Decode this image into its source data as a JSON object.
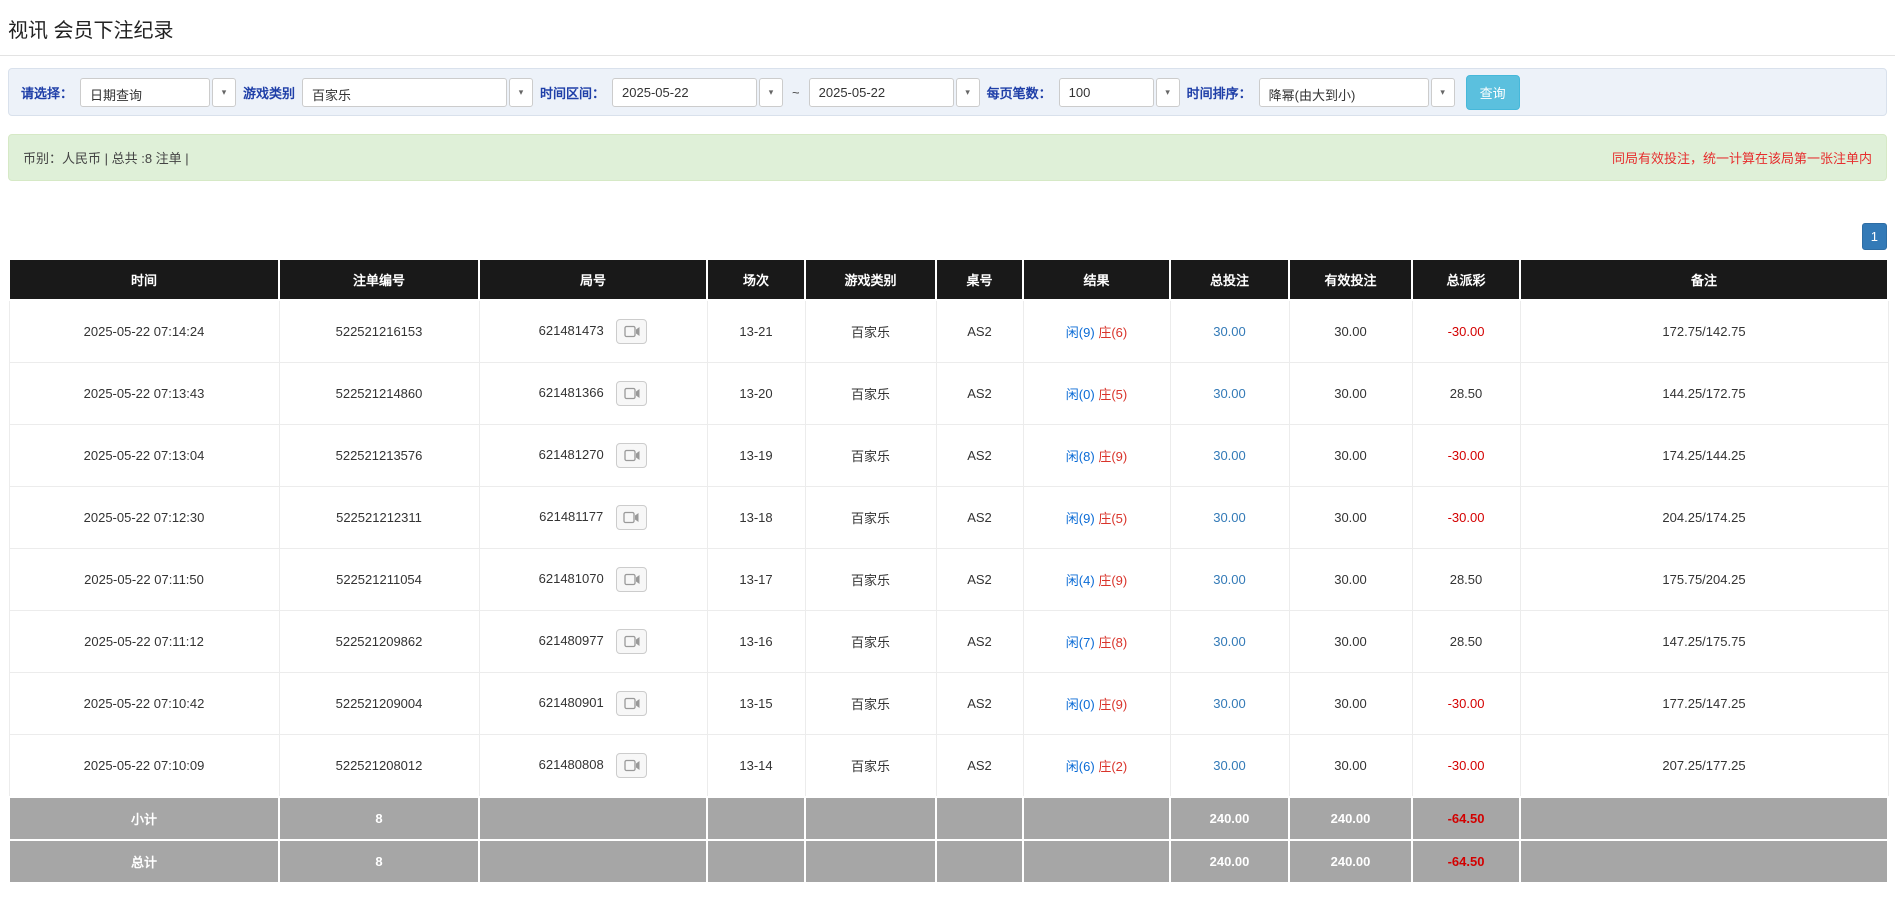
{
  "page": {
    "title": "视讯 会员下注纪录"
  },
  "filters": {
    "select_label": "请选择：",
    "select_value": "日期查询",
    "game_type_label": "游戏类别",
    "game_type_value": "百家乐",
    "date_range_label": "时间区间：",
    "date_from": "2025-05-22",
    "date_separator": "~",
    "date_to": "2025-05-22",
    "page_size_label": "每页笔数：",
    "page_size_value": "100",
    "sort_label": "时间排序：",
    "sort_value": "降幂(由大到小)",
    "search_button": "查询"
  },
  "summary": {
    "left": "币别：人民币 | 总共 :8 注单 |",
    "right": "同局有效投注，统一计算在该局第一张注单内"
  },
  "pagination": {
    "current": "1"
  },
  "icons": {
    "select_caret": "chevron-down",
    "round_media": "video-camera"
  },
  "colors": {
    "accent_blue": "#337ab7",
    "search_button": "#5bc0de",
    "player_blue": "#0a6bd6",
    "banker_red": "#d9342b",
    "negative_red": "#d30000",
    "header_black": "#191919",
    "summary_green": "#dff0d8",
    "filter_bg": "#edf2f9",
    "sum_row_gray": "#a6a6a6"
  },
  "table": {
    "headers": [
      "时间",
      "注单编号",
      "局号",
      "场次",
      "游戏类别",
      "桌号",
      "结果",
      "总投注",
      "有效投注",
      "总派彩",
      "备注"
    ],
    "rows": [
      {
        "time": "2025-05-22 07:14:24",
        "bet_id": "522521216153",
        "round_id": "621481473",
        "session": "13-21",
        "game": "百家乐",
        "table_no": "AS2",
        "player": "闲(9)",
        "banker": "庄(6)",
        "total_bet": "30.00",
        "valid_bet": "30.00",
        "payout": "-30.00",
        "remark": "172.75/142.75"
      },
      {
        "time": "2025-05-22 07:13:43",
        "bet_id": "522521214860",
        "round_id": "621481366",
        "session": "13-20",
        "game": "百家乐",
        "table_no": "AS2",
        "player": "闲(0)",
        "banker": "庄(5)",
        "total_bet": "30.00",
        "valid_bet": "30.00",
        "payout": "28.50",
        "remark": "144.25/172.75"
      },
      {
        "time": "2025-05-22 07:13:04",
        "bet_id": "522521213576",
        "round_id": "621481270",
        "session": "13-19",
        "game": "百家乐",
        "table_no": "AS2",
        "player": "闲(8)",
        "banker": "庄(9)",
        "total_bet": "30.00",
        "valid_bet": "30.00",
        "payout": "-30.00",
        "remark": "174.25/144.25"
      },
      {
        "time": "2025-05-22 07:12:30",
        "bet_id": "522521212311",
        "round_id": "621481177",
        "session": "13-18",
        "game": "百家乐",
        "table_no": "AS2",
        "player": "闲(9)",
        "banker": "庄(5)",
        "total_bet": "30.00",
        "valid_bet": "30.00",
        "payout": "-30.00",
        "remark": "204.25/174.25"
      },
      {
        "time": "2025-05-22 07:11:50",
        "bet_id": "522521211054",
        "round_id": "621481070",
        "session": "13-17",
        "game": "百家乐",
        "table_no": "AS2",
        "player": "闲(4)",
        "banker": "庄(9)",
        "total_bet": "30.00",
        "valid_bet": "30.00",
        "payout": "28.50",
        "remark": "175.75/204.25"
      },
      {
        "time": "2025-05-22 07:11:12",
        "bet_id": "522521209862",
        "round_id": "621480977",
        "session": "13-16",
        "game": "百家乐",
        "table_no": "AS2",
        "player": "闲(7)",
        "banker": "庄(8)",
        "total_bet": "30.00",
        "valid_bet": "30.00",
        "payout": "28.50",
        "remark": "147.25/175.75"
      },
      {
        "time": "2025-05-22 07:10:42",
        "bet_id": "522521209004",
        "round_id": "621480901",
        "session": "13-15",
        "game": "百家乐",
        "table_no": "AS2",
        "player": "闲(0)",
        "banker": "庄(9)",
        "total_bet": "30.00",
        "valid_bet": "30.00",
        "payout": "-30.00",
        "remark": "177.25/147.25"
      },
      {
        "time": "2025-05-22 07:10:09",
        "bet_id": "522521208012",
        "round_id": "621480808",
        "session": "13-14",
        "game": "百家乐",
        "table_no": "AS2",
        "player": "闲(6)",
        "banker": "庄(2)",
        "total_bet": "30.00",
        "valid_bet": "30.00",
        "payout": "-30.00",
        "remark": "207.25/177.25"
      }
    ],
    "subtotal": {
      "label": "小计",
      "count": "8",
      "total_bet": "240.00",
      "valid_bet": "240.00",
      "payout": "-64.50"
    },
    "total": {
      "label": "总计",
      "count": "8",
      "total_bet": "240.00",
      "valid_bet": "240.00",
      "payout": "-64.50"
    }
  }
}
